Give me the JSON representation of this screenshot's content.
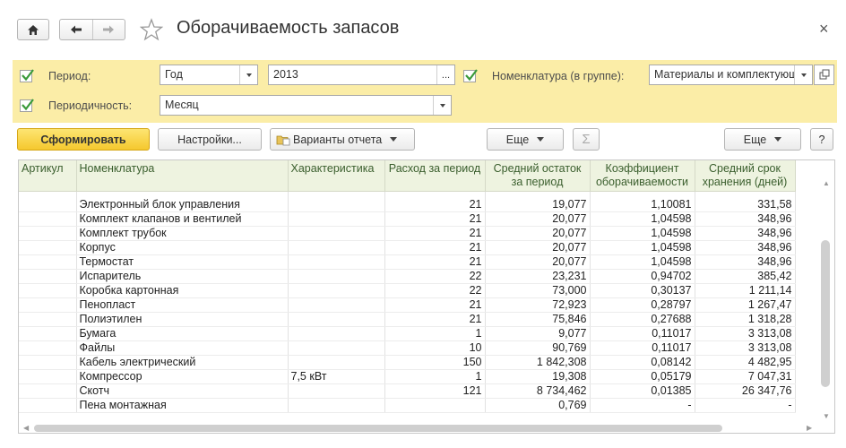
{
  "title": "Оборачиваемость запасов",
  "filters": {
    "period_label": "Период:",
    "period_type": "Год",
    "period_value": "2013",
    "period_value_btn": "...",
    "periodicity_label": "Периодичность:",
    "periodicity_value": "Месяц",
    "nomenclature_label": "Номенклатура (в группе):",
    "nomenclature_value": "Материалы и комплектующие"
  },
  "toolbar": {
    "generate": "Сформировать",
    "settings": "Настройки...",
    "variants": "Варианты отчета",
    "more1": "Еще",
    "sum": "Σ",
    "more2": "Еще",
    "help": "?"
  },
  "table": {
    "headers": [
      "Артикул",
      "Номенклатура",
      "Характеристика",
      "Расход за период",
      "Средний остаток за период",
      "Коэффициент оборачиваемости",
      "Средний срок хранения (дней)"
    ],
    "rows": [
      [
        "",
        "Электронный блок управления",
        "",
        "21",
        "19,077",
        "1,10081",
        "331,58"
      ],
      [
        "",
        "Комплект клапанов и вентилей",
        "",
        "21",
        "20,077",
        "1,04598",
        "348,96"
      ],
      [
        "",
        "Комплект трубок",
        "",
        "21",
        "20,077",
        "1,04598",
        "348,96"
      ],
      [
        "",
        "Корпус",
        "",
        "21",
        "20,077",
        "1,04598",
        "348,96"
      ],
      [
        "",
        "Термостат",
        "",
        "21",
        "20,077",
        "1,04598",
        "348,96"
      ],
      [
        "",
        "Испаритель",
        "",
        "22",
        "23,231",
        "0,94702",
        "385,42"
      ],
      [
        "",
        "Коробка картонная",
        "",
        "22",
        "73,000",
        "0,30137",
        "1 211,14"
      ],
      [
        "",
        "Пенопласт",
        "",
        "21",
        "72,923",
        "0,28797",
        "1 267,47"
      ],
      [
        "",
        "Полиэтилен",
        "",
        "21",
        "75,846",
        "0,27688",
        "1 318,28"
      ],
      [
        "",
        "Бумага",
        "",
        "1",
        "9,077",
        "0,11017",
        "3 313,08"
      ],
      [
        "",
        "Файлы",
        "",
        "10",
        "90,769",
        "0,11017",
        "3 313,08"
      ],
      [
        "",
        "Кабель электрический",
        "",
        "150",
        "1 842,308",
        "0,08142",
        "4 482,95"
      ],
      [
        "",
        "Компрессор",
        "7,5 кВт",
        "1",
        "19,308",
        "0,05179",
        "7 047,31"
      ],
      [
        "",
        "Скотч",
        "",
        "121",
        "8 734,462",
        "0,01385",
        "26 347,76"
      ],
      [
        "",
        "Пена монтажная",
        "",
        "",
        "0,769",
        "-",
        "-"
      ]
    ]
  },
  "colors": {
    "filter_bg": "#fbeda7",
    "primary_btn": "#f5c82e",
    "header_bg": "#eef3e0",
    "header_text": "#3a5e2d",
    "check": "#3a9a3a"
  },
  "icons": [
    "home-icon",
    "back-arrow-icon",
    "forward-arrow-icon",
    "star-icon",
    "close-icon",
    "checkbox-icon",
    "dropdown-icon",
    "open-icon",
    "variants-icon"
  ]
}
